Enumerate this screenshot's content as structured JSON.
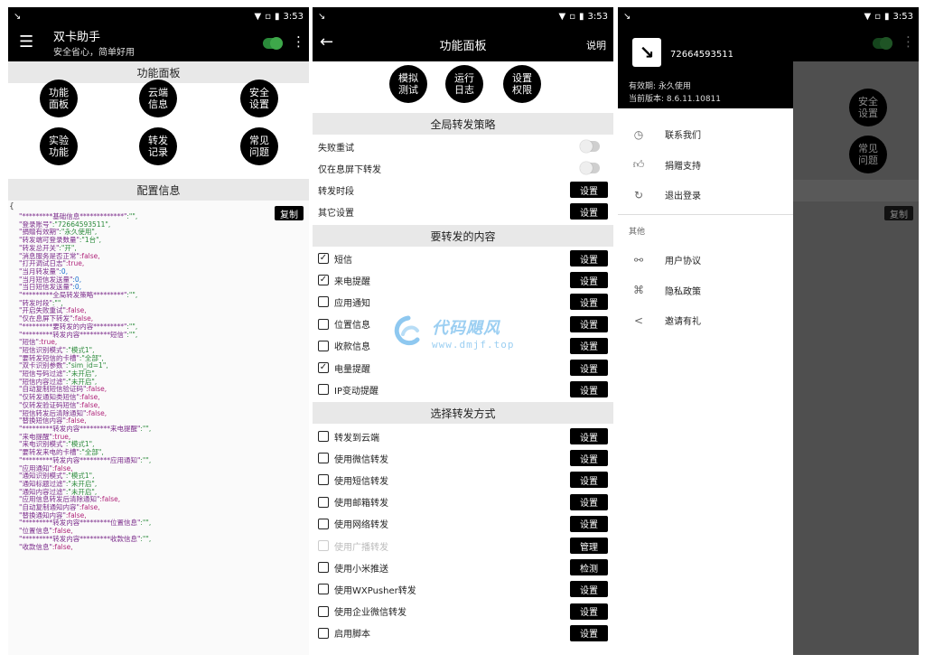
{
  "status": {
    "time": "3:53"
  },
  "screen1": {
    "title": "双卡助手",
    "subtitle": "安全省心，简单好用",
    "section_panel": "功能面板",
    "buttons": [
      "功能\n面板",
      "云端\n信息",
      "安全\n设置",
      "实验\n功能",
      "转发\n记录",
      "常见\n问题"
    ],
    "section_config": "配置信息",
    "copy_label": "复制",
    "config_lines": [
      [
        "\"*********基础信息*************\"",
        ":\"\","
      ],
      [
        "\"登录账号\"",
        ":\"72664593511\","
      ],
      [
        "\"捐赠有效期\"",
        ":\"永久使用\","
      ],
      [
        "\"转发端可登录数量\"",
        ":\"1台\","
      ],
      [
        "\"转发总开关\"",
        ":\"开\","
      ],
      [
        "\"消息服务是否正常\"",
        ":false,"
      ],
      [
        "\"打开调试日志\"",
        ":true,"
      ],
      [
        "\"当月转发量\"",
        ":0,"
      ],
      [
        "\"当月短信发送量\"",
        ":0,"
      ],
      [
        "\"当日短信发送量\"",
        ":0,"
      ],
      [
        "\"*********全局转发策略*********\"",
        ":\"\","
      ],
      [
        "\"转发时段\"",
        ":\"\","
      ],
      [
        "\"开启失败重试\"",
        ":false,"
      ],
      [
        "\"仅在息屏下转发\"",
        ":false,"
      ],
      [
        "\"*********要转发的内容*********\"",
        ":\"\","
      ],
      [
        "\"*********转发内容*********短信\"",
        ":\"\","
      ],
      [
        "\"短信\"",
        ":true,"
      ],
      [
        "\"短信识别模式\"",
        ":\"模式1\","
      ],
      [
        "\"要转发短信的卡槽\"",
        ":\"全部\","
      ],
      [
        "\"双卡识别参数\"",
        ":\"sim_id=1\","
      ],
      [
        "\"短信号码过滤\"",
        ":\"未开启\","
      ],
      [
        "\"短信内容过滤\"",
        ":\"未开启\","
      ],
      [
        "\"自动复制短信验证码\"",
        ":false,"
      ],
      [
        "\"仅转发通知类短信\"",
        ":false,"
      ],
      [
        "\"仅转发验证码短信\"",
        ":false,"
      ],
      [
        "\"短信转发后清除通知\"",
        ":false,"
      ],
      [
        "\"替换短信内容\"",
        ":false,"
      ],
      [
        "\"*********转发内容*********来电提醒\"",
        ":\"\","
      ],
      [
        "\"来电提醒\"",
        ":true,"
      ],
      [
        "\"来电识别模式\"",
        ":\"模式1\","
      ],
      [
        "\"要转发来电的卡槽\"",
        ":\"全部\","
      ],
      [
        "\"*********转发内容*********应用通知\"",
        ":\"\","
      ],
      [
        "\"应用通知\"",
        ":false,"
      ],
      [
        "\"通知识别模式\"",
        ":\"模式1\","
      ],
      [
        "\"通知标题过滤\"",
        ":\"未开启\","
      ],
      [
        "\"通知内容过滤\"",
        ":\"未开启\","
      ],
      [
        "\"应用信息转发后清除通知\"",
        ":false,"
      ],
      [
        "\"自动复制通知内容\"",
        ":false,"
      ],
      [
        "\"替换通知内容\"",
        ":false,"
      ],
      [
        "\"*********转发内容*********位置信息\"",
        ":\"\","
      ],
      [
        "\"位置信息\"",
        ":false,"
      ],
      [
        "\"*********转发内容*********收款信息\"",
        ":\"\","
      ],
      [
        "\"收款信息\"",
        ":false,"
      ]
    ]
  },
  "screen2": {
    "title": "功能面板",
    "help": "说明",
    "top_buttons": [
      "模拟\n测试",
      "运行\n日志",
      "设置\n权限"
    ],
    "section_global": "全局转发策略",
    "global_rows": [
      {
        "label": "失败重试",
        "control": "toggle"
      },
      {
        "label": "仅在息屏下转发",
        "control": "toggle"
      },
      {
        "label": "转发时段",
        "control": "button",
        "button": "设置"
      },
      {
        "label": "其它设置",
        "control": "button",
        "button": "设置"
      }
    ],
    "section_content": "要转发的内容",
    "content_rows": [
      {
        "label": "短信",
        "checked": true,
        "button": "设置"
      },
      {
        "label": "来电提醒",
        "checked": true,
        "button": "设置"
      },
      {
        "label": "应用通知",
        "checked": false,
        "button": "设置"
      },
      {
        "label": "位置信息",
        "checked": false,
        "button": "设置"
      },
      {
        "label": "收款信息",
        "checked": false,
        "button": "设置"
      },
      {
        "label": "电量提醒",
        "checked": true,
        "button": "设置"
      },
      {
        "label": "IP变动提醒",
        "checked": false,
        "button": "设置"
      }
    ],
    "section_method": "选择转发方式",
    "method_rows": [
      {
        "label": "转发到云端",
        "checked": false,
        "button": "设置"
      },
      {
        "label": "使用微信转发",
        "checked": false,
        "button": "设置"
      },
      {
        "label": "使用短信转发",
        "checked": false,
        "button": "设置"
      },
      {
        "label": "使用邮箱转发",
        "checked": false,
        "button": "设置"
      },
      {
        "label": "使用网络转发",
        "checked": false,
        "button": "设置"
      },
      {
        "label": "使用广播转发",
        "checked": false,
        "button": "管理",
        "disabled": true
      },
      {
        "label": "使用小米推送",
        "checked": false,
        "button": "检测"
      },
      {
        "label": "使用WXPusher转发",
        "checked": false,
        "button": "设置"
      },
      {
        "label": "使用企业微信转发",
        "checked": false,
        "button": "设置"
      },
      {
        "label": "启用脚本",
        "checked": false,
        "button": "设置"
      }
    ]
  },
  "screen3": {
    "account": "72664593511",
    "validity": "有效期: 永久使用",
    "version": "当前版本: 8.6.11.10811",
    "menu": [
      {
        "icon": "clock-icon",
        "label": "联系我们"
      },
      {
        "icon": "thumb-up-icon",
        "label": "捐赠支持"
      },
      {
        "icon": "logout-icon",
        "label": "退出登录"
      }
    ],
    "other_label": "其他",
    "other_menu": [
      {
        "icon": "link-icon",
        "label": "用户协议"
      },
      {
        "icon": "privacy-icon",
        "label": "隐私政策"
      },
      {
        "icon": "share-icon",
        "label": "邀请有礼"
      }
    ],
    "bg_buttons": [
      "安全\n设置",
      "常见\n问题"
    ],
    "bg_copy": "复制"
  },
  "watermark": {
    "title": "代码飓风",
    "url": "www.dmjf.top"
  },
  "colors": {
    "accent_green": "#2a8a3a",
    "key_purple": "#7a2a8a",
    "string_green": "#2a8a3a",
    "bool_pink": "#b0247a",
    "num_blue": "#1b6fd0"
  }
}
